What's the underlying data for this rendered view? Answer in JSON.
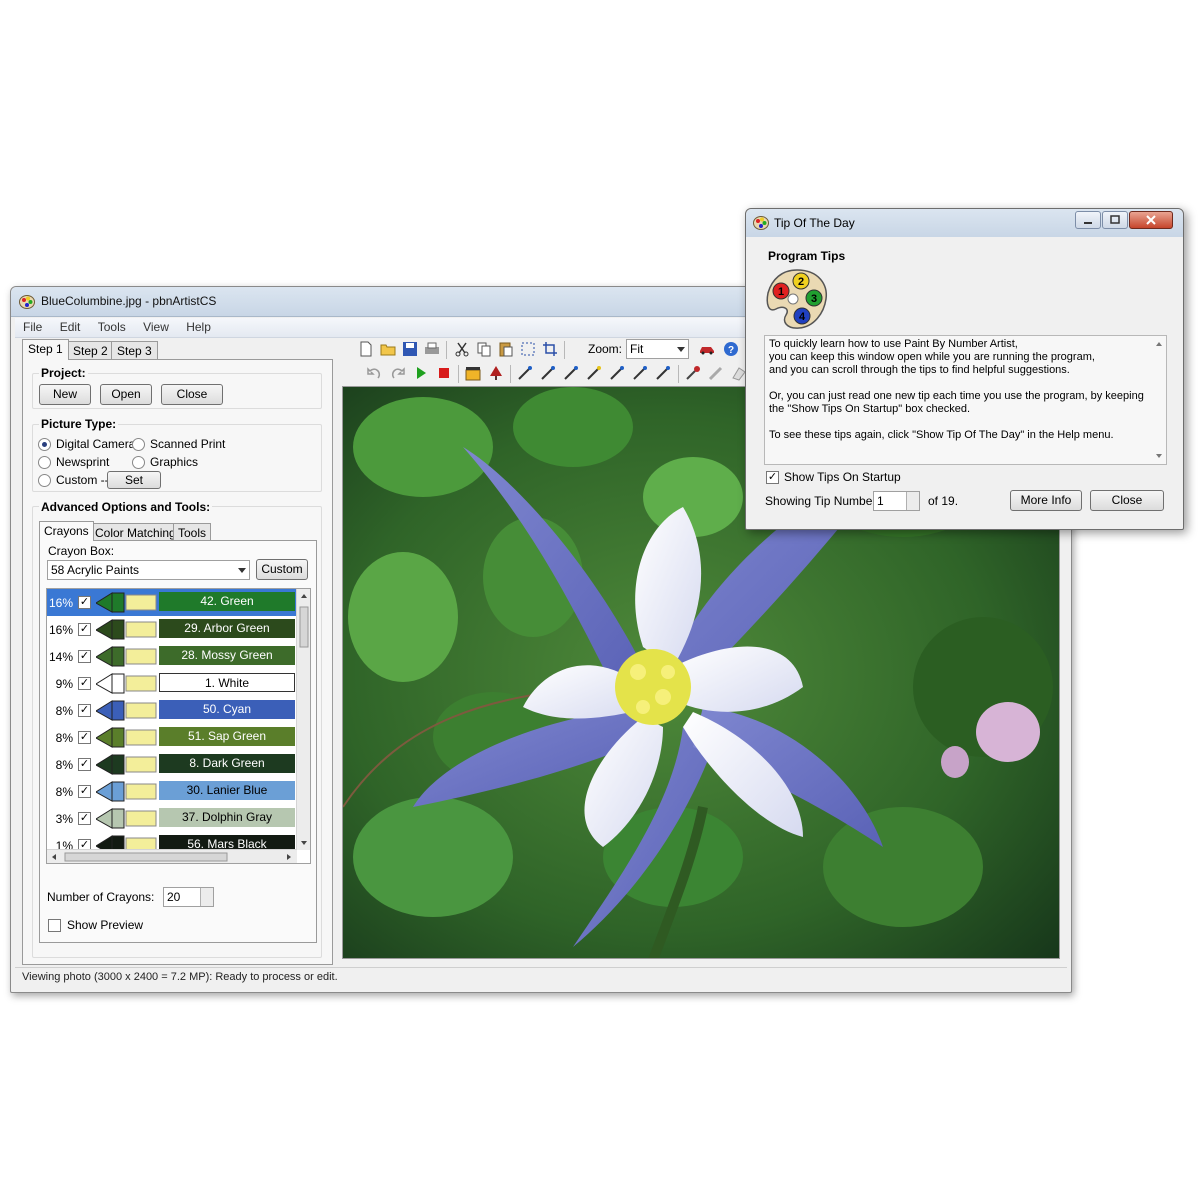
{
  "main_window": {
    "title": "BlueColumbine.jpg - pbnArtistCS",
    "menu": [
      "File",
      "Edit",
      "Tools",
      "View",
      "Help"
    ],
    "step_tabs": [
      "Step 1",
      "Step 2",
      "Step 3"
    ],
    "project": {
      "label": "Project:",
      "buttons": [
        "New",
        "Open",
        "Close"
      ]
    },
    "picture_type": {
      "label": "Picture Type:",
      "options": [
        "Digital Camera",
        "Scanned Print",
        "Newsprint",
        "Graphics",
        "Custom --"
      ],
      "selected": "Digital Camera",
      "set_button": "Set"
    },
    "advanced": {
      "label": "Advanced Options and Tools:",
      "tabs": [
        "Crayons",
        "Color Matching",
        "Tools"
      ],
      "crayon_box_label": "Crayon Box:",
      "crayon_box_value": "58 Acrylic Paints",
      "custom_button": "Custom",
      "crayons": [
        {
          "pct": "16%",
          "name": "42.  Green",
          "color": "#1f7a2a",
          "text": "#ffffff",
          "selected": true
        },
        {
          "pct": "16%",
          "name": "29.  Arbor Green",
          "color": "#2c4a1c",
          "text": "#ffffff"
        },
        {
          "pct": "14%",
          "name": "28.  Mossy Green",
          "color": "#3d6b2a",
          "text": "#ffffff"
        },
        {
          "pct": "9%",
          "name": "1.  White",
          "color": "#ffffff",
          "text": "#000000"
        },
        {
          "pct": "8%",
          "name": "50.  Cyan",
          "color": "#3b5fb8",
          "text": "#ffffff"
        },
        {
          "pct": "8%",
          "name": "51.  Sap Green",
          "color": "#5a7e2a",
          "text": "#ffffff"
        },
        {
          "pct": "8%",
          "name": "8.  Dark Green",
          "color": "#1d3a20",
          "text": "#ffffff"
        },
        {
          "pct": "8%",
          "name": "30.  Lanier Blue",
          "color": "#6b9fd6",
          "text": "#000000"
        },
        {
          "pct": "3%",
          "name": "37.  Dolphin Gray",
          "color": "#b6c7b0",
          "text": "#000000"
        },
        {
          "pct": "1%",
          "name": "56.  Mars Black",
          "color": "#121a12",
          "text": "#ffffff"
        }
      ],
      "num_crayons_label": "Number of Crayons:",
      "num_crayons_value": "20",
      "show_preview_label": "Show Preview"
    },
    "toolbar": {
      "zoom_label": "Zoom:",
      "zoom_value": "Fit"
    },
    "status": "Viewing photo (3000 x 2400 = 7.2 MP):  Ready to process or edit."
  },
  "tip_dialog": {
    "title": "Tip Of The Day",
    "heading": "Program Tips",
    "paragraphs": [
      "To quickly learn how to use Paint By Number Artist,\nyou can keep this window open while you are running the program,\nand you can scroll through the tips to find helpful suggestions.",
      "Or, you can just read one new tip each time you use the program, by keeping\nthe \"Show Tips On Startup\" box checked.",
      "To see these tips again, click \"Show Tip Of The Day\" in the Help menu."
    ],
    "show_tips_label": "Show Tips On Startup",
    "tip_number_label": "Showing Tip Number",
    "tip_number_value": "1",
    "tip_total": "of 19.",
    "more_info_button": "More Info",
    "close_button": "Close",
    "palette_numbers": [
      "1",
      "2",
      "3",
      "4"
    ]
  },
  "colors": {
    "selection": "#3a78d4",
    "titlebar": "#c8d6e6",
    "window_bg": "#f0f0f0"
  }
}
